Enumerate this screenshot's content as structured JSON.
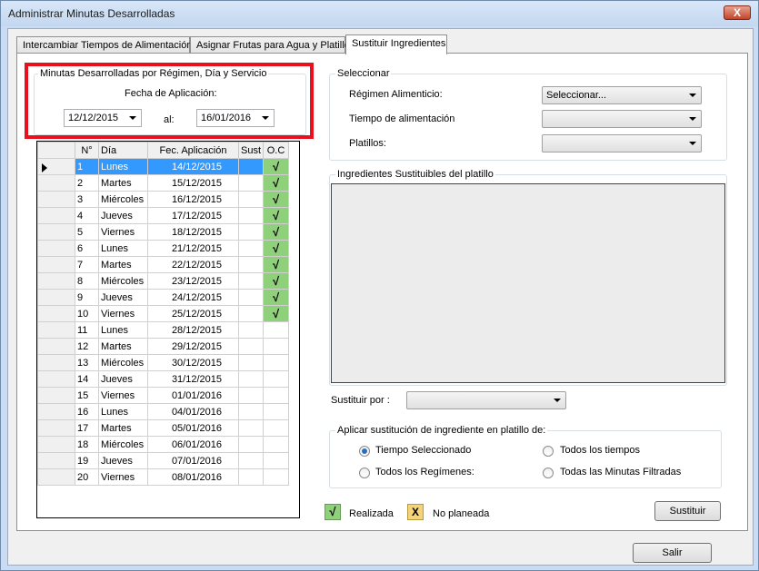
{
  "window": {
    "title": "Administrar Minutas Desarrolladas",
    "close_label": "X"
  },
  "tabs": [
    {
      "label": "Intercambiar Tiempos de Alimentación"
    },
    {
      "label": "Asignar Frutas para Agua y Platillo"
    },
    {
      "label": "Sustituir Ingredientes",
      "active": true
    }
  ],
  "filter": {
    "group_title": "Minutas Desarrolladas por Régimen, Día y Servicio",
    "fecha_label": "Fecha de Aplicación:",
    "date_from": "12/12/2015",
    "al_label": "al:",
    "date_to": "16/01/2016"
  },
  "grid": {
    "columns": [
      "N°",
      "Día",
      "Fec. Aplicación",
      "Sust",
      "O.C"
    ],
    "rows": [
      {
        "n": "1",
        "dia": "Lunes",
        "fecha": "14/12/2015",
        "oc": "√",
        "selected": true
      },
      {
        "n": "2",
        "dia": "Martes",
        "fecha": "15/12/2015",
        "oc": "√"
      },
      {
        "n": "3",
        "dia": "Miércoles",
        "fecha": "16/12/2015",
        "oc": "√"
      },
      {
        "n": "4",
        "dia": "Jueves",
        "fecha": "17/12/2015",
        "oc": "√"
      },
      {
        "n": "5",
        "dia": "Viernes",
        "fecha": "18/12/2015",
        "oc": "√"
      },
      {
        "n": "6",
        "dia": "Lunes",
        "fecha": "21/12/2015",
        "oc": "√"
      },
      {
        "n": "7",
        "dia": "Martes",
        "fecha": "22/12/2015",
        "oc": "√"
      },
      {
        "n": "8",
        "dia": "Miércoles",
        "fecha": "23/12/2015",
        "oc": "√"
      },
      {
        "n": "9",
        "dia": "Jueves",
        "fecha": "24/12/2015",
        "oc": "√"
      },
      {
        "n": "10",
        "dia": "Viernes",
        "fecha": "25/12/2015",
        "oc": "√"
      },
      {
        "n": "11",
        "dia": "Lunes",
        "fecha": "28/12/2015",
        "oc": ""
      },
      {
        "n": "12",
        "dia": "Martes",
        "fecha": "29/12/2015",
        "oc": ""
      },
      {
        "n": "13",
        "dia": "Miércoles",
        "fecha": "30/12/2015",
        "oc": ""
      },
      {
        "n": "14",
        "dia": "Jueves",
        "fecha": "31/12/2015",
        "oc": ""
      },
      {
        "n": "15",
        "dia": "Viernes",
        "fecha": "01/01/2016",
        "oc": ""
      },
      {
        "n": "16",
        "dia": "Lunes",
        "fecha": "04/01/2016",
        "oc": ""
      },
      {
        "n": "17",
        "dia": "Martes",
        "fecha": "05/01/2016",
        "oc": ""
      },
      {
        "n": "18",
        "dia": "Miércoles",
        "fecha": "06/01/2016",
        "oc": ""
      },
      {
        "n": "19",
        "dia": "Jueves",
        "fecha": "07/01/2016",
        "oc": ""
      },
      {
        "n": "20",
        "dia": "Viernes",
        "fecha": "08/01/2016",
        "oc": ""
      }
    ]
  },
  "select_group": {
    "title": "Seleccionar",
    "regimen_label": "Régimen Alimenticio:",
    "regimen_value": "Seleccionar...",
    "tiempo_label": "Tiempo de alimentación",
    "tiempo_value": "",
    "platillos_label": "Platillos:",
    "platillos_value": ""
  },
  "ingredients": {
    "title": "Ingredientes Sustituibles del platillo"
  },
  "sustituir_por": {
    "label": "Sustituir por :",
    "value": ""
  },
  "apply_group": {
    "title": "Aplicar sustitución de ingrediente en platillo de:",
    "options": [
      {
        "label": "Tiempo Seleccionado",
        "checked": true
      },
      {
        "label": "Todos los tiempos",
        "checked": false
      },
      {
        "label": "Todos los Regímenes:",
        "checked": false
      },
      {
        "label": "Todas las Minutas Filtradas",
        "checked": false
      }
    ]
  },
  "legend": {
    "ok_symbol": "√",
    "ok_label": "Realizada",
    "x_symbol": "X",
    "x_label": "No planeada"
  },
  "buttons": {
    "sustituir": "Sustituir",
    "salir": "Salir"
  },
  "colors": {
    "highlight": "#e8101c",
    "done": "#8fd07a",
    "not_planned": "#f3d47a",
    "selection": "#3399ff"
  }
}
